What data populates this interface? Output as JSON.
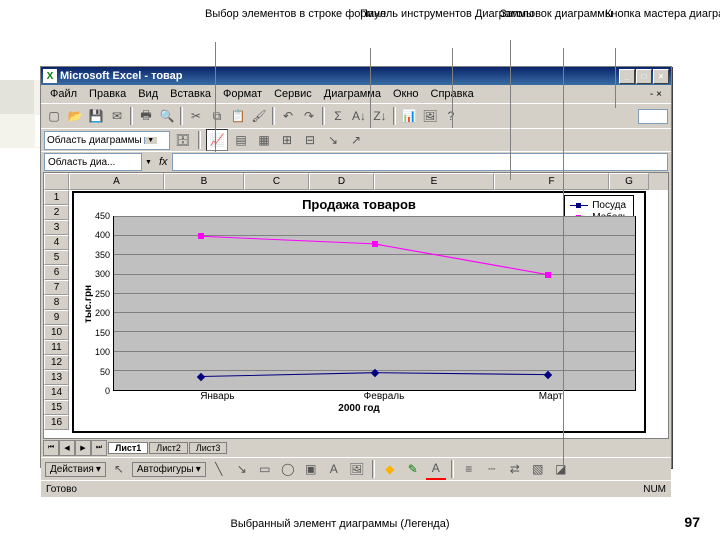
{
  "callouts": {
    "c1": "Выбор элементов\nв строке формул",
    "c2": "Панель\nинструментов\nДиаграммы",
    "c3": "Заголовок\nдиаграммы",
    "c4": "Кнопка\nмастера\nдиаграмм"
  },
  "title": "Microsoft Excel - товар",
  "menu": [
    "Файл",
    "Правка",
    "Вид",
    "Вставка",
    "Формат",
    "Сервис",
    "Диаграмма",
    "Окно",
    "Справка"
  ],
  "help_hint": "-  ×",
  "combo_chart": "Область диаграммы",
  "namebox": "Область диа...",
  "cols": [
    "A",
    "B",
    "C",
    "D",
    "E",
    "F",
    "G"
  ],
  "rows": [
    "1",
    "2",
    "3",
    "4",
    "5",
    "6",
    "7",
    "8",
    "9",
    "10",
    "11",
    "12",
    "13",
    "14",
    "15",
    "16"
  ],
  "sheets": [
    "Лист1",
    "Лист2",
    "Лист3"
  ],
  "drawing": {
    "actions": "Действия",
    "autoshapes": "Автофигуры"
  },
  "status": {
    "left": "Готово",
    "right": "NUM"
  },
  "bottom_callout": "Выбранный элемент диаграммы (Легенда)",
  "page": "97",
  "chart_data": {
    "type": "line",
    "title": "Продажа товаров",
    "xlabel": "2000 год",
    "ylabel": "тыс.грн",
    "categories": [
      "Январь",
      "Февраль",
      "Март"
    ],
    "ylim": [
      0,
      450
    ],
    "yticks": [
      0,
      50,
      100,
      150,
      200,
      250,
      300,
      350,
      400,
      450
    ],
    "series": [
      {
        "name": "Посуда",
        "color": "#000080",
        "marker": "diamond",
        "values": [
          35,
          45,
          40
        ]
      },
      {
        "name": "Мебель",
        "color": "#ff00ff",
        "marker": "square",
        "values": [
          400,
          380,
          300
        ]
      }
    ]
  }
}
